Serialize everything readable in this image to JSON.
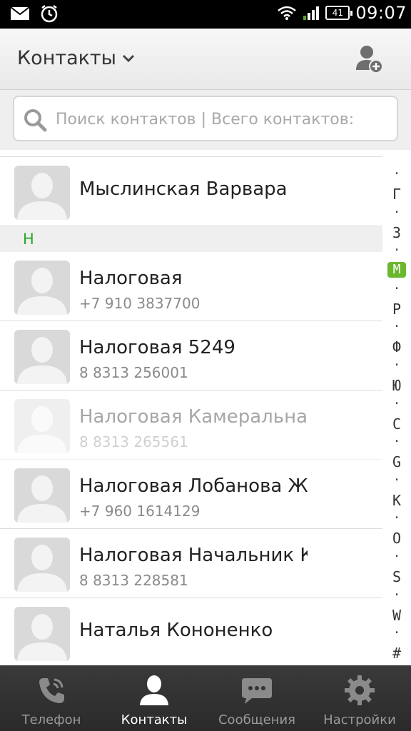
{
  "status_bar": {
    "time": "09:07",
    "battery": "41"
  },
  "header": {
    "title": "Контакты"
  },
  "search": {
    "placeholder": "Поиск контактов | Всего контактов:"
  },
  "contacts_before": [
    {
      "name": "Мыслинская Варвара",
      "phone": ""
    }
  ],
  "section": {
    "letter": "Н"
  },
  "contacts": [
    {
      "name": "Налоговая",
      "phone": "+7 910 3837700"
    },
    {
      "name": "Налоговая 5249",
      "phone": "8 8313 256001"
    },
    {
      "name": "Налоговая Камеральна",
      "phone": "8 8313 265561"
    },
    {
      "name": "Налоговая Лобанова Ж",
      "phone": "+7 960 1614129"
    },
    {
      "name": "Налоговая Начальник К",
      "phone": "8 8313 228581"
    },
    {
      "name": "Наталья Кононенко",
      "phone": ""
    }
  ],
  "alphabet": [
    "Г",
    "З",
    "М",
    "Р",
    "Ф",
    "Ю",
    "С",
    "G",
    "K",
    "O",
    "S",
    "W",
    "#"
  ],
  "alphabet_active": "М",
  "bottom_nav": [
    {
      "label": "Телефон",
      "icon": "phone-icon"
    },
    {
      "label": "Контакты",
      "icon": "contact-icon"
    },
    {
      "label": "Сообщения",
      "icon": "message-icon"
    },
    {
      "label": "Настройки",
      "icon": "gear-icon"
    }
  ],
  "colors": {
    "accent_green": "#6bb82f",
    "section_text": "#2aa52a"
  }
}
